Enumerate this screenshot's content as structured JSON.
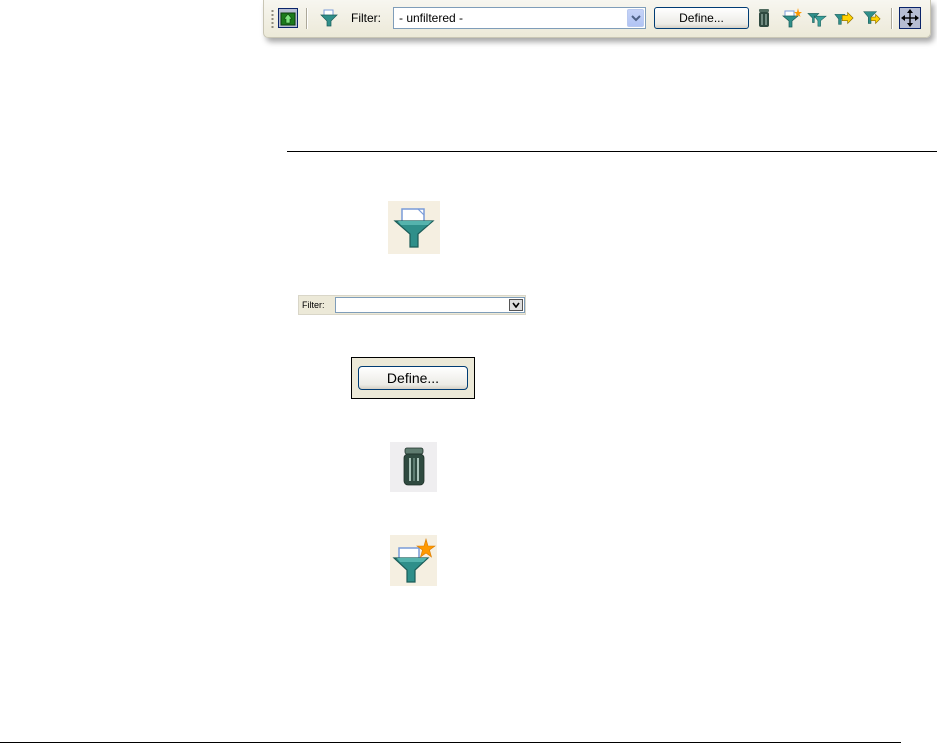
{
  "toolbar": {
    "filter_label": "Filter:",
    "filter_value": "- unfiltered -",
    "define_label": "Define...",
    "icons": [
      "home-up-icon",
      "filter-icon",
      "dropdown-arrow-icon",
      "trash-icon",
      "new-filter-icon",
      "filter-copy-icon",
      "filter-export-icon",
      "filter-import-icon",
      "move-icon"
    ]
  },
  "callouts": {
    "filter_icon": "filter-icon",
    "mini_filter_label": "Filter:",
    "define_label": "Define...",
    "trash_icon": "trash-icon",
    "new_filter_icon": "new-filter-icon"
  },
  "colors": {
    "toolbar_bg": "#ece9d8",
    "funnel_teal": "#2f8f8a",
    "highlight_blue": "#0a246a",
    "star_orange": "#ff9900"
  }
}
